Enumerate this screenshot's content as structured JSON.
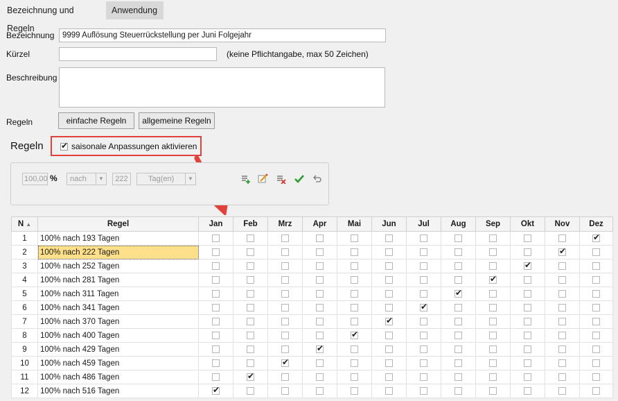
{
  "tabs": [
    "Bezeichnung und Regeln",
    "Anwendung"
  ],
  "form": {
    "bezeichnung_label": "Bezeichnung",
    "bezeichnung_value": "9999 Auflösung Steuerrückstellung per Juni Folgejahr",
    "kuerzel_label": "Kürzel",
    "kuerzel_value": "",
    "kuerzel_hint": "(keine Pflichtangabe, max 50 Zeichen)",
    "beschreibung_label": "Beschreibung",
    "beschreibung_value": "",
    "regeln_label": "Regeln",
    "btn_einfache": "einfache Regeln",
    "btn_allgemeine": "allgemeine Regeln"
  },
  "regeln": {
    "title": "Regeln",
    "seasonal_label": "saisonale Anpassungen aktivieren",
    "seasonal_checked": true,
    "percent_value": "100,00",
    "percent_sign": "%",
    "nach_value": "nach",
    "days_value": "222",
    "unit_value": "Tag(en)"
  },
  "icons": [
    "add-row-icon",
    "edit-icon",
    "delete-icon",
    "confirm-icon",
    "undo-icon"
  ],
  "colors": {
    "highlight": "#e2403a",
    "selected_cell": "#ffe08a",
    "confirm": "#2a9d2a",
    "delete": "#d23232"
  },
  "table": {
    "col_n": "N",
    "col_regel": "Regel",
    "months": [
      "Jan",
      "Feb",
      "Mrz",
      "Apr",
      "Mai",
      "Jun",
      "Jul",
      "Aug",
      "Sep",
      "Okt",
      "Nov",
      "Dez"
    ],
    "selected_row": 2,
    "rows": [
      {
        "n": "1",
        "regel": "100% nach 193 Tagen",
        "checked": 11
      },
      {
        "n": "2",
        "regel": "100% nach 222 Tagen",
        "checked": 10
      },
      {
        "n": "3",
        "regel": "100% nach 252 Tagen",
        "checked": 9
      },
      {
        "n": "4",
        "regel": "100% nach 281 Tagen",
        "checked": 8
      },
      {
        "n": "5",
        "regel": "100% nach 311 Tagen",
        "checked": 7
      },
      {
        "n": "6",
        "regel": "100% nach 341 Tagen",
        "checked": 6
      },
      {
        "n": "7",
        "regel": "100% nach 370 Tagen",
        "checked": 5
      },
      {
        "n": "8",
        "regel": "100% nach 400 Tagen",
        "checked": 4
      },
      {
        "n": "9",
        "regel": "100% nach 429 Tagen",
        "checked": 3
      },
      {
        "n": "10",
        "regel": "100% nach 459 Tagen",
        "checked": 2
      },
      {
        "n": "11",
        "regel": "100% nach 486 Tagen",
        "checked": 1
      },
      {
        "n": "12",
        "regel": "100% nach 516 Tagen",
        "checked": 0
      }
    ]
  }
}
